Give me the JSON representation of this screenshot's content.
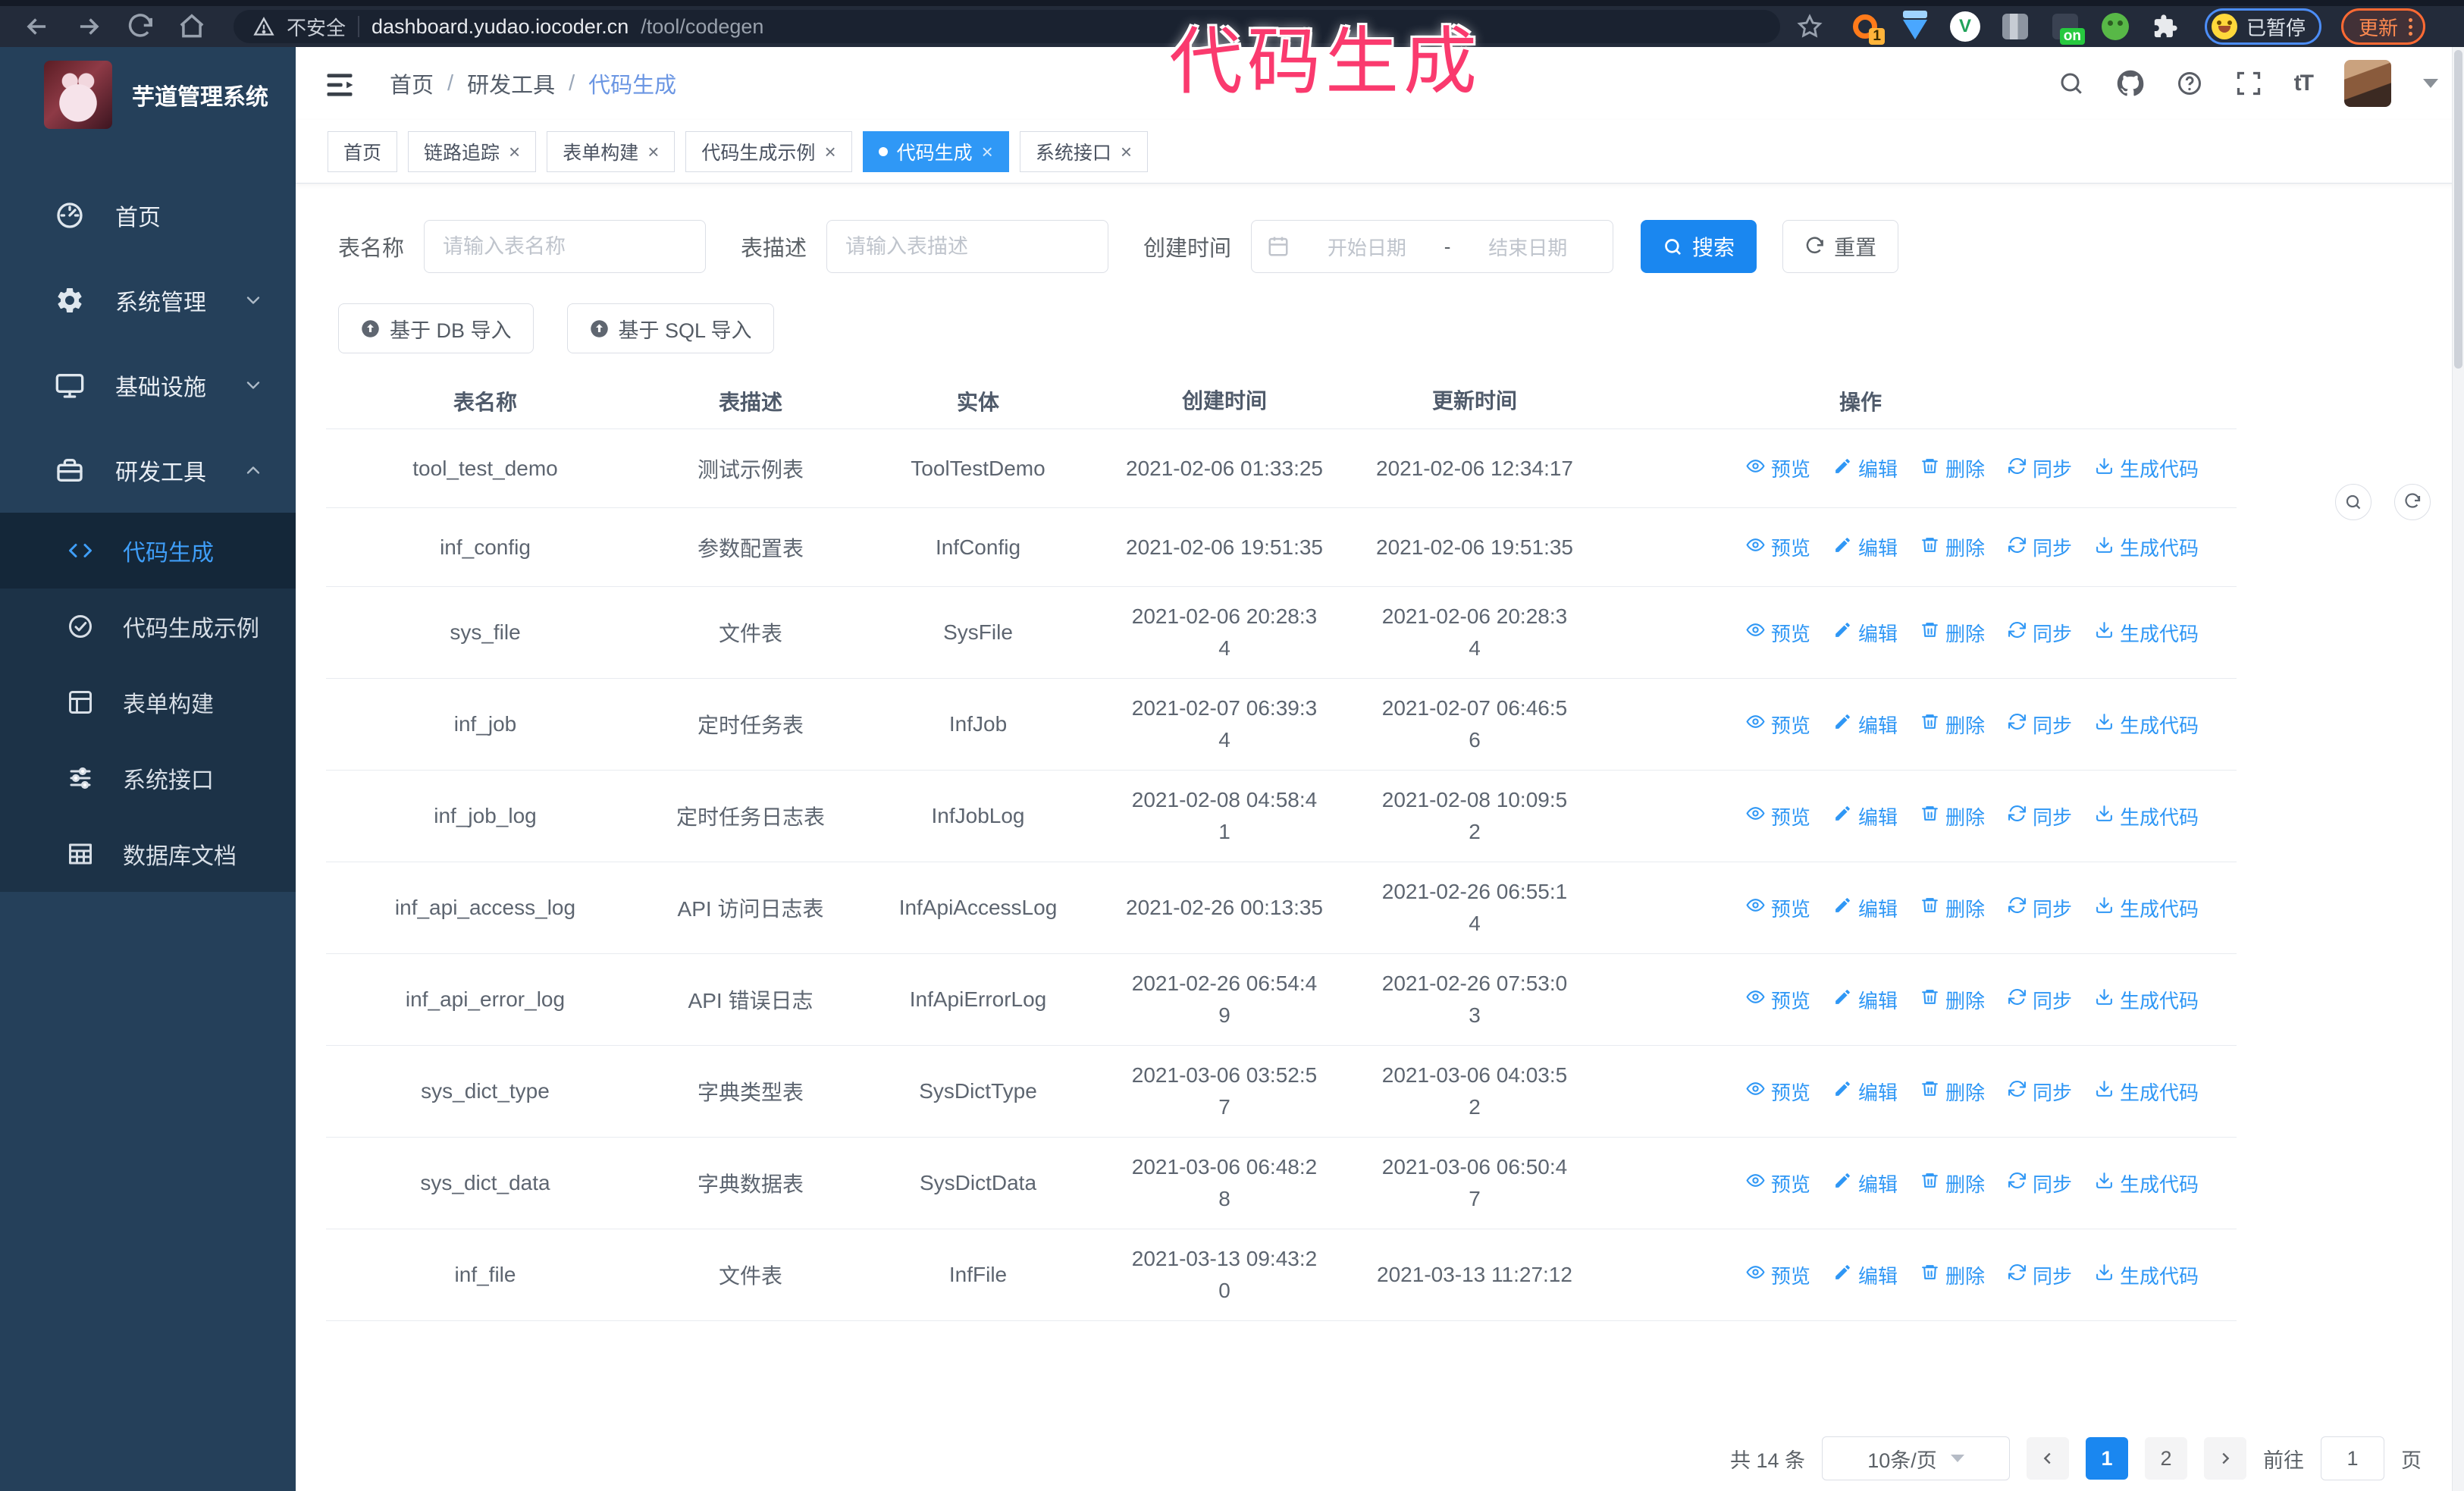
{
  "browser": {
    "security_label": "不安全",
    "url_host": "dashboard.yudao.iocoder.cn",
    "url_path": "/tool/codegen",
    "ext_badge": "1",
    "ext_on_badge": "on",
    "ext_v_label": "V",
    "profile_chip": "已暂停",
    "update_button": "更新"
  },
  "annotation": {
    "text": "代码生成",
    "color": "#fa3a6e"
  },
  "sidebar": {
    "logo_title": "芋道管理系统",
    "items": [
      {
        "label": "首页",
        "icon": "dashboard",
        "expandable": false,
        "expanded": false
      },
      {
        "label": "系统管理",
        "icon": "gear",
        "expandable": true,
        "expanded": false
      },
      {
        "label": "基础设施",
        "icon": "monitor",
        "expandable": true,
        "expanded": false
      },
      {
        "label": "研发工具",
        "icon": "tools",
        "expandable": true,
        "expanded": true
      }
    ],
    "submenu": [
      {
        "label": "代码生成",
        "icon": "code",
        "active": true
      },
      {
        "label": "代码生成示例",
        "icon": "example",
        "active": false
      },
      {
        "label": "表单构建",
        "icon": "form",
        "active": false
      },
      {
        "label": "系统接口",
        "icon": "api",
        "active": false
      },
      {
        "label": "数据库文档",
        "icon": "db",
        "active": false
      }
    ]
  },
  "breadcrumb": [
    "首页",
    "研发工具",
    "代码生成"
  ],
  "tabs": [
    {
      "label": "首页",
      "closable": false,
      "active": false
    },
    {
      "label": "链路追踪",
      "closable": true,
      "active": false
    },
    {
      "label": "表单构建",
      "closable": true,
      "active": false
    },
    {
      "label": "代码生成示例",
      "closable": true,
      "active": false
    },
    {
      "label": "代码生成",
      "closable": true,
      "active": true
    },
    {
      "label": "系统接口",
      "closable": true,
      "active": false
    }
  ],
  "filters": {
    "table_name_label": "表名称",
    "table_name_placeholder": "请输入表名称",
    "table_desc_label": "表描述",
    "table_desc_placeholder": "请输入表描述",
    "create_time_label": "创建时间",
    "date_start_placeholder": "开始日期",
    "date_separator": "-",
    "date_end_placeholder": "结束日期",
    "search_label": "搜索",
    "reset_label": "重置"
  },
  "toolbar": {
    "import_db_label": "基于 DB 导入",
    "import_sql_label": "基于 SQL 导入"
  },
  "table": {
    "columns": [
      "表名称",
      "表描述",
      "实体",
      "创建时间",
      "更新时间",
      "操作"
    ],
    "action_labels": [
      "预览",
      "编辑",
      "删除",
      "同步",
      "生成代码"
    ],
    "rows": [
      {
        "name": "tool_test_demo",
        "desc": "测试示例表",
        "entity": "ToolTestDemo",
        "created": [
          "2021-02-06 01:33:25"
        ],
        "updated": [
          "2021-02-06 12:34:17"
        ]
      },
      {
        "name": "inf_config",
        "desc": "参数配置表",
        "entity": "InfConfig",
        "created": [
          "2021-02-06 19:51:35"
        ],
        "updated": [
          "2021-02-06 19:51:35"
        ]
      },
      {
        "name": "sys_file",
        "desc": "文件表",
        "entity": "SysFile",
        "created": [
          "2021-02-06 20:28:3",
          "4"
        ],
        "updated": [
          "2021-02-06 20:28:3",
          "4"
        ]
      },
      {
        "name": "inf_job",
        "desc": "定时任务表",
        "entity": "InfJob",
        "created": [
          "2021-02-07 06:39:3",
          "4"
        ],
        "updated": [
          "2021-02-07 06:46:5",
          "6"
        ]
      },
      {
        "name": "inf_job_log",
        "desc": "定时任务日志表",
        "entity": "InfJobLog",
        "created": [
          "2021-02-08 04:58:4",
          "1"
        ],
        "updated": [
          "2021-02-08 10:09:5",
          "2"
        ]
      },
      {
        "name": "inf_api_access_log",
        "desc": "API 访问日志表",
        "entity": "InfApiAccessLog",
        "created": [
          "2021-02-26 00:13:35"
        ],
        "updated": [
          "2021-02-26 06:55:1",
          "4"
        ]
      },
      {
        "name": "inf_api_error_log",
        "desc": "API 错误日志",
        "entity": "InfApiErrorLog",
        "created": [
          "2021-02-26 06:54:4",
          "9"
        ],
        "updated": [
          "2021-02-26 07:53:0",
          "3"
        ]
      },
      {
        "name": "sys_dict_type",
        "desc": "字典类型表",
        "entity": "SysDictType",
        "created": [
          "2021-03-06 03:52:5",
          "7"
        ],
        "updated": [
          "2021-03-06 04:03:5",
          "2"
        ]
      },
      {
        "name": "sys_dict_data",
        "desc": "字典数据表",
        "entity": "SysDictData",
        "created": [
          "2021-03-06 06:48:2",
          "8"
        ],
        "updated": [
          "2021-03-06 06:50:4",
          "7"
        ]
      },
      {
        "name": "inf_file",
        "desc": "文件表",
        "entity": "InfFile",
        "created": [
          "2021-03-13 09:43:2",
          "0"
        ],
        "updated": [
          "2021-03-13 11:27:12"
        ]
      }
    ]
  },
  "pagination": {
    "total_label": "共 14 条",
    "page_size_label": "10条/页",
    "pages": [
      "1",
      "2"
    ],
    "active_page": "1",
    "goto_label": "前往",
    "goto_value": "1",
    "goto_suffix_label": "页"
  },
  "colors": {
    "accent": "#2f98f6",
    "primary_button": "#1a87f0",
    "sidebar_bg": "#25405a",
    "submenu_bg": "#1c3247"
  }
}
